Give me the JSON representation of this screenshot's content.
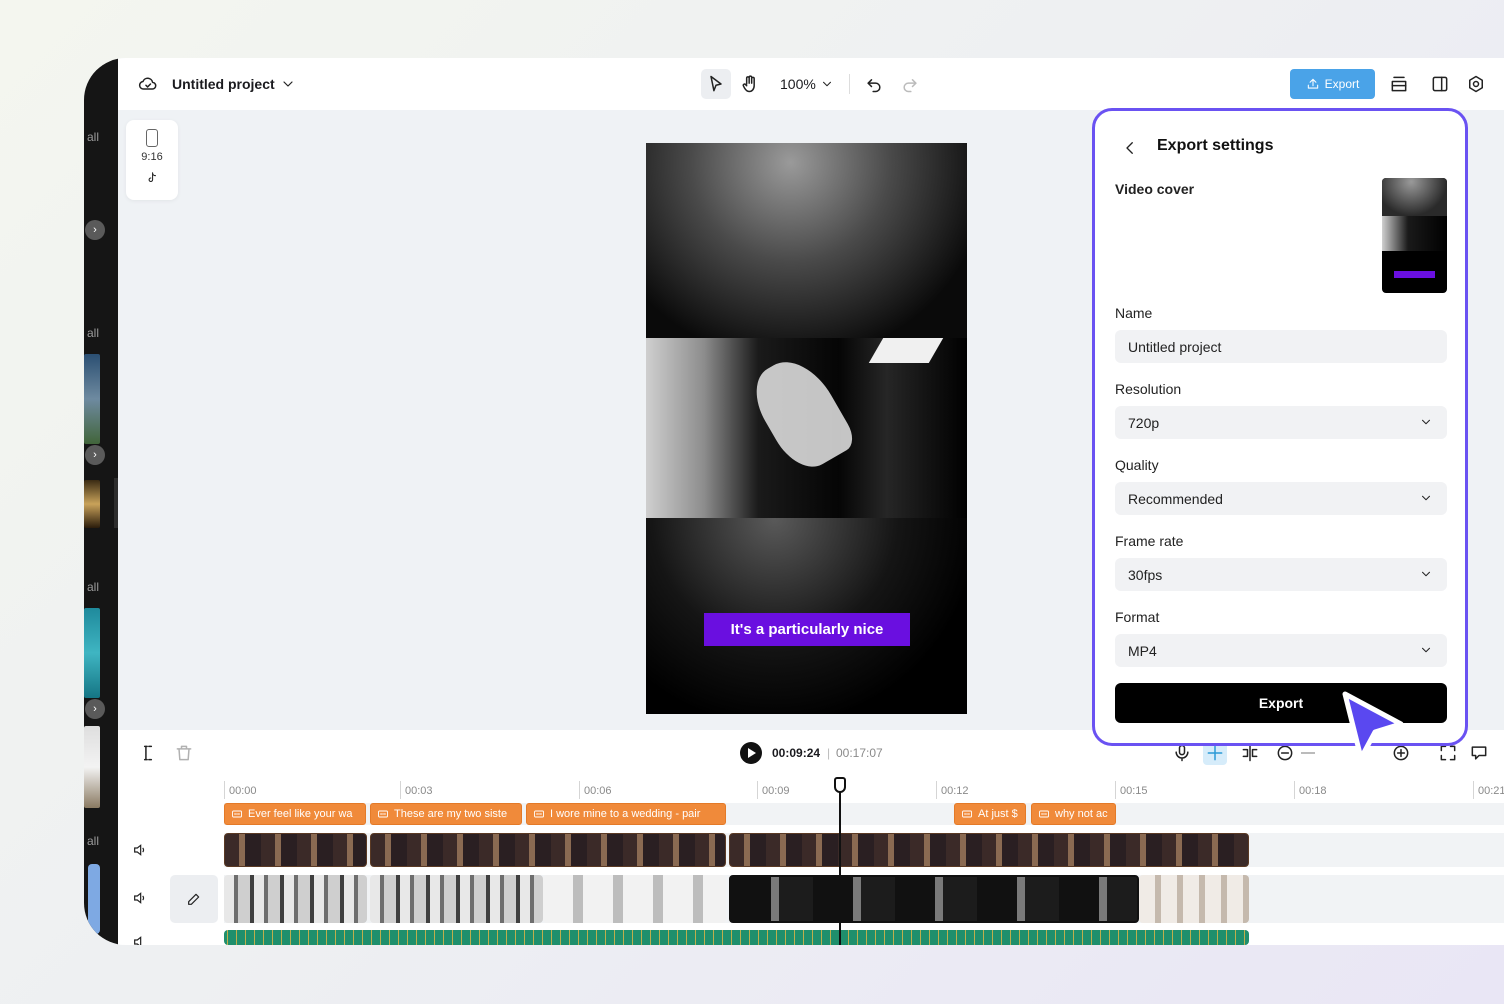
{
  "project": {
    "title": "Untitled project"
  },
  "toolbar": {
    "zoom": "100%",
    "export_label": "Export"
  },
  "canvas": {
    "ratio_label": "9:16",
    "caption_text": "It's a particularly nice"
  },
  "playback": {
    "current_time": "00:09:24",
    "separator": "|",
    "total_time": "00:17:07"
  },
  "timeline": {
    "ticks": [
      "00:00",
      "00:03",
      "00:06",
      "00:09",
      "00:12",
      "00:15",
      "00:18",
      "00:21"
    ],
    "subtitles": [
      "Ever feel like your wa",
      "These are my two siste",
      "I wore mine to a wedding - pair",
      "At just $",
      "why not ac"
    ]
  },
  "sidebar": {
    "section_label": "all"
  },
  "export_panel": {
    "title": "Export settings",
    "cover_label": "Video cover",
    "name_label": "Name",
    "name_value": "Untitled project",
    "resolution_label": "Resolution",
    "resolution_value": "720p",
    "quality_label": "Quality",
    "quality_value": "Recommended",
    "framerate_label": "Frame rate",
    "framerate_value": "30fps",
    "format_label": "Format",
    "format_value": "MP4",
    "export_button": "Export"
  },
  "colors": {
    "accent": "#4aa3e8",
    "panel_border": "#6a52f2",
    "caption_bg": "#6a0fe0",
    "subtitle_clip": "#f08a3a"
  }
}
